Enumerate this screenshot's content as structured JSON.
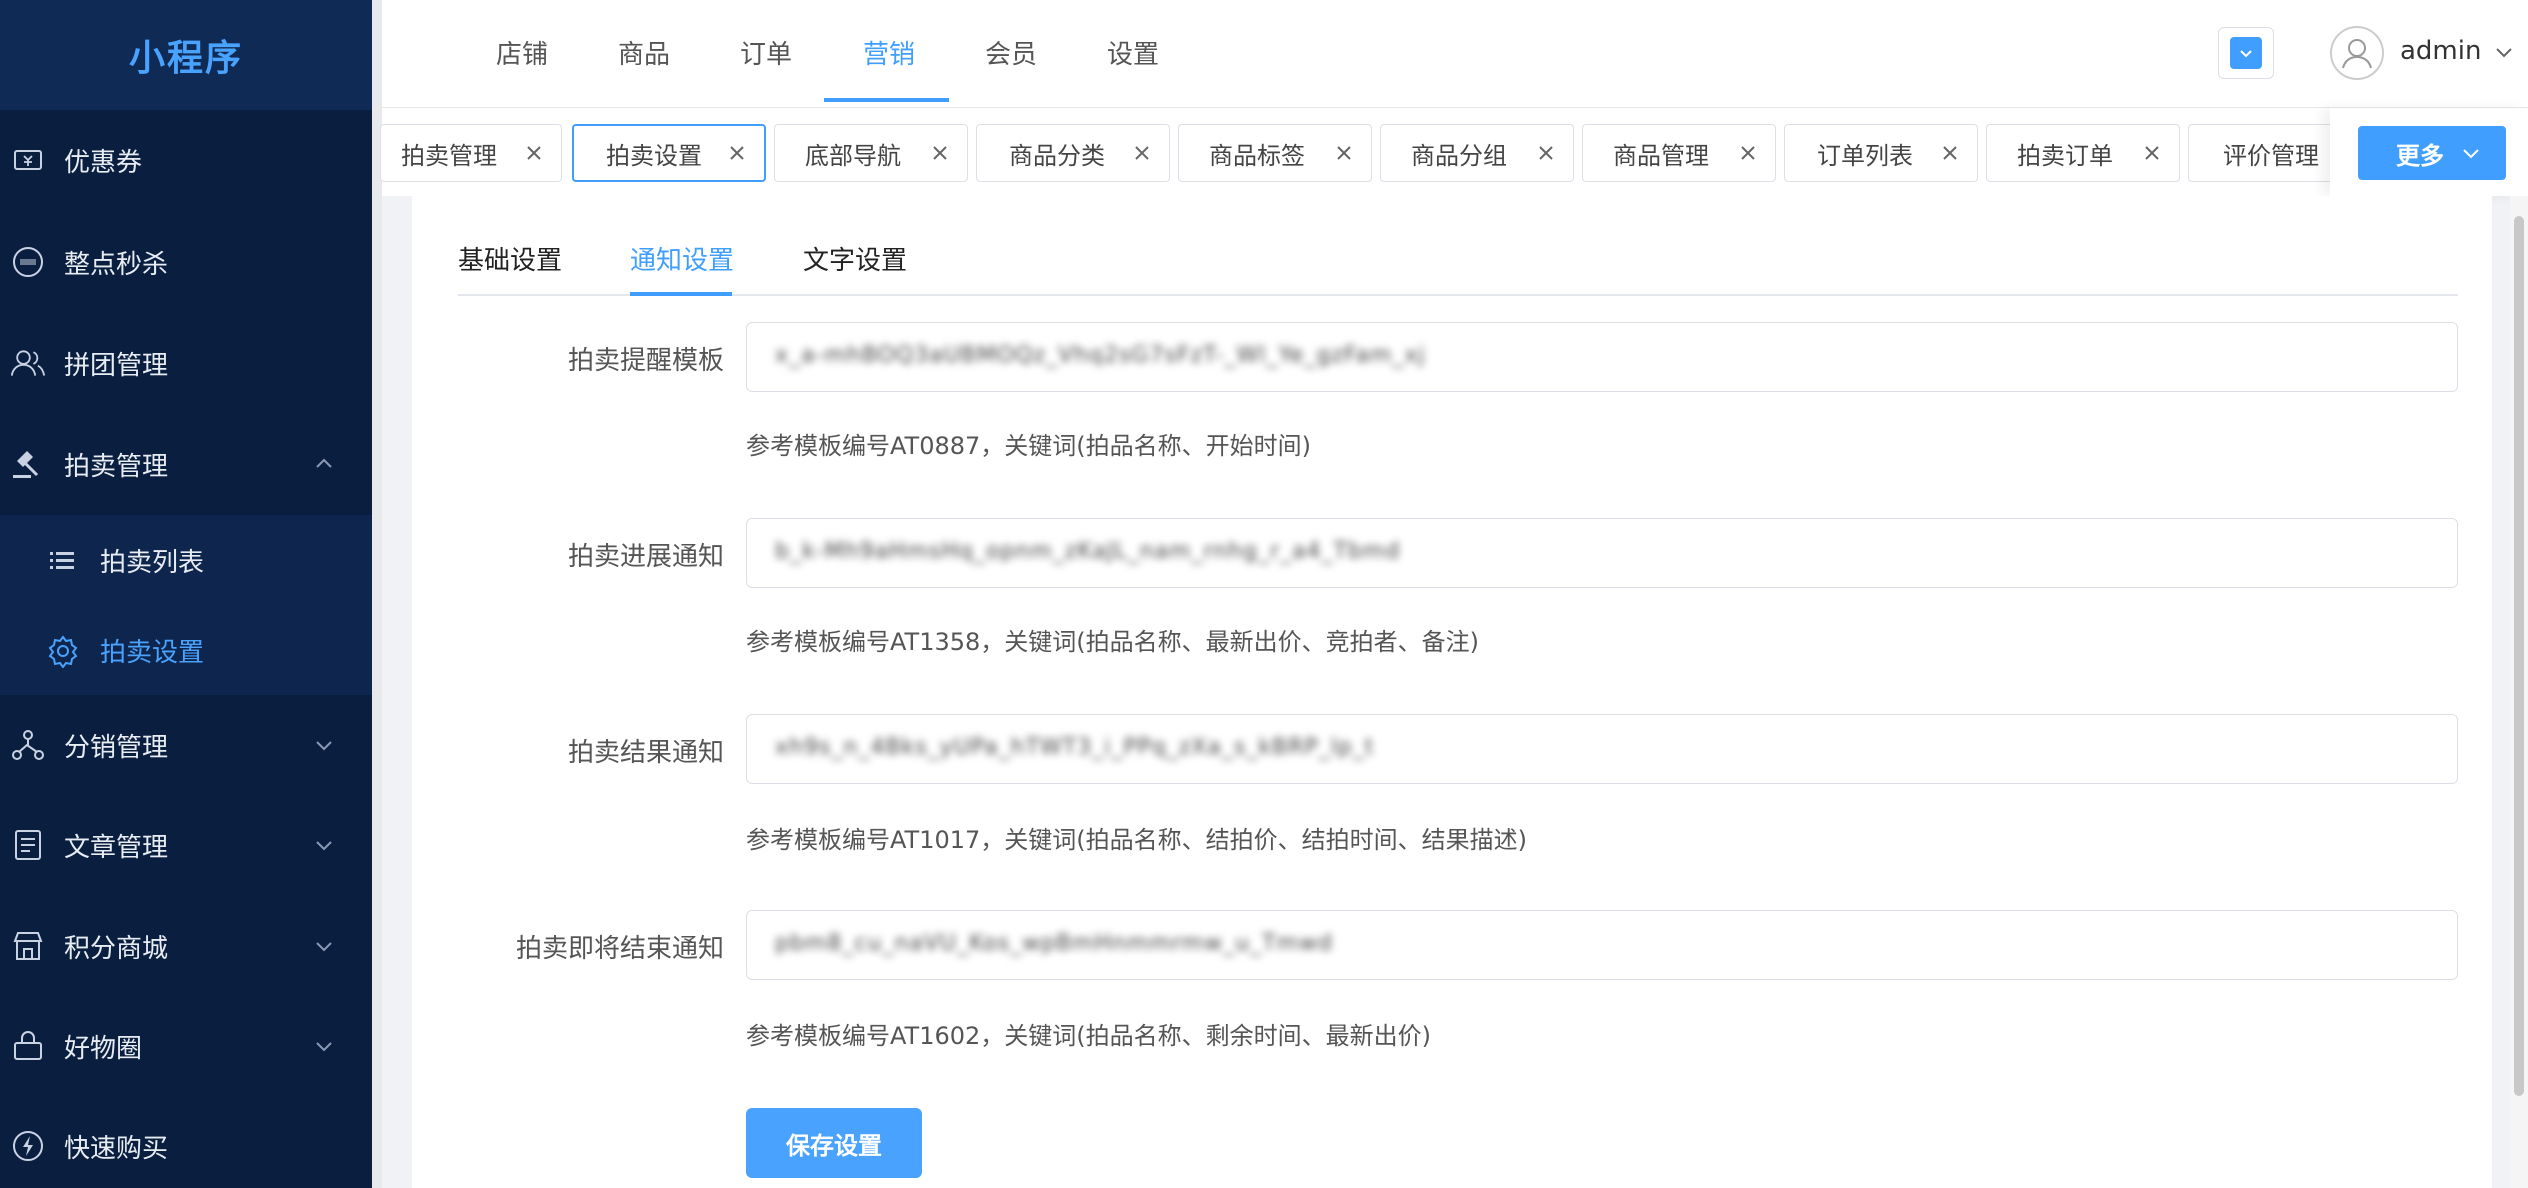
{
  "sidebar": {
    "brand": "小程序",
    "items": [
      {
        "label": "优惠券",
        "icon": "coupon-icon"
      },
      {
        "label": "整点秒杀",
        "icon": "seckill-icon"
      },
      {
        "label": "拼团管理",
        "icon": "group-icon"
      },
      {
        "label": "拍卖管理",
        "icon": "gavel-icon",
        "expanded": true
      },
      {
        "label": "分销管理",
        "icon": "distribution-icon"
      },
      {
        "label": "文章管理",
        "icon": "article-icon"
      },
      {
        "label": "积分商城",
        "icon": "store-icon"
      },
      {
        "label": "好物圈",
        "icon": "goods-circle-icon"
      },
      {
        "label": "快速购买",
        "icon": "lightning-icon"
      }
    ],
    "sub_items": [
      {
        "label": "拍卖列表",
        "icon": "list-icon"
      },
      {
        "label": "拍卖设置",
        "icon": "gear-icon",
        "active": true
      }
    ]
  },
  "header": {
    "nav": [
      "店铺",
      "商品",
      "订单",
      "营销",
      "会员",
      "设置"
    ],
    "active_nav": "营销",
    "user_name": "admin"
  },
  "tabs": {
    "items": [
      "拍卖管理",
      "拍卖设置",
      "底部导航",
      "商品分类",
      "商品标签",
      "商品分组",
      "商品管理",
      "订单列表",
      "拍卖订单",
      "评价管理"
    ],
    "active": "拍卖设置",
    "more_label": "更多"
  },
  "settings_tabs": {
    "items": [
      "基础设置",
      "通知设置",
      "文字设置"
    ],
    "active": "通知设置"
  },
  "form": {
    "fields": [
      {
        "label": "拍卖提醒模板",
        "value": "x_a-mhBOQ3aUBMOQz_Vhq2sG7sFzT-_Wl_Ye_gzFam_xj",
        "hint": "参考模板编号AT0887，关键词(拍品名称、开始时间)"
      },
      {
        "label": "拍卖进展通知",
        "value": "b_k-Mh9aHmsHq_opnm_zKaJL_nam_rnhg_r_a4_Tbmd",
        "hint": "参考模板编号AT1358，关键词(拍品名称、最新出价、竞拍者、备注)"
      },
      {
        "label": "拍卖结果通知",
        "value": "xh9s_n_4Bks_yUPa_hTWT3_i_PPq_zXa_s_kBRP_lp_t",
        "hint": "参考模板编号AT1017，关键词(拍品名称、结拍价、结拍时间、结果描述)"
      },
      {
        "label": "拍卖即将结束通知",
        "value": "pbm8_cu_naVU_Kos_wpBmHnmmrmw_u_Tmwd",
        "hint": "参考模板编号AT1602，关键词(拍品名称、剩余时间、最新出价)"
      }
    ],
    "save_label": "保存设置"
  },
  "colors": {
    "primary": "#409eff",
    "sidebar_bg": "#0a1f3f",
    "brand_bg": "#0e2a55"
  }
}
